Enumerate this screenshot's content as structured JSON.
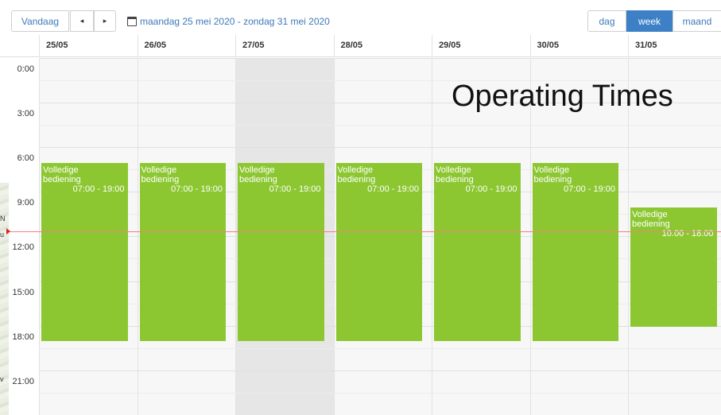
{
  "toolbar": {
    "today_label": "Vandaag",
    "prev_icon": "◂",
    "next_icon": "▸",
    "date_range": "maandag 25 mei 2020 - zondag 31 mei 2020",
    "view_day": "dag",
    "view_week": "week",
    "view_month": "maand",
    "active_view": "week"
  },
  "days": [
    {
      "label": "25/05"
    },
    {
      "label": "26/05"
    },
    {
      "label": "27/05",
      "highlighted": true
    },
    {
      "label": "28/05"
    },
    {
      "label": "29/05"
    },
    {
      "label": "30/05"
    },
    {
      "label": "31/05"
    }
  ],
  "times": [
    "0:00",
    "3:00",
    "6:00",
    "9:00",
    "12:00",
    "15:00",
    "18:00",
    "21:00"
  ],
  "events": [
    {
      "day": 0,
      "title1": "Volledige",
      "title2": "bediening",
      "time": "07:00 - 19:00",
      "start": 7,
      "end": 19
    },
    {
      "day": 1,
      "title1": "Volledige",
      "title2": "bediening",
      "time": "07:00 - 19:00",
      "start": 7,
      "end": 19
    },
    {
      "day": 2,
      "title1": "Volledige",
      "title2": "bediening",
      "time": "07:00 - 19:00",
      "start": 7,
      "end": 19
    },
    {
      "day": 3,
      "title1": "Volledige",
      "title2": "bediening",
      "time": "07:00 - 19:00",
      "start": 7,
      "end": 19
    },
    {
      "day": 4,
      "title1": "Volledige",
      "title2": "bediening",
      "time": "07:00 - 19:00",
      "start": 7,
      "end": 19
    },
    {
      "day": 5,
      "title1": "Volledige",
      "title2": "bediening",
      "time": "07:00 - 19:00",
      "start": 7,
      "end": 19
    },
    {
      "day": 6,
      "title1": "Volledige",
      "title2": "bediening",
      "time": "10:00 - 18:00",
      "start": 10,
      "end": 18
    }
  ],
  "overlay_title": "Operating Times",
  "colors": {
    "event": "#8cc732",
    "accent": "#3d80c6",
    "today_column": "#e6e6e6",
    "now_line": "#f08080"
  }
}
